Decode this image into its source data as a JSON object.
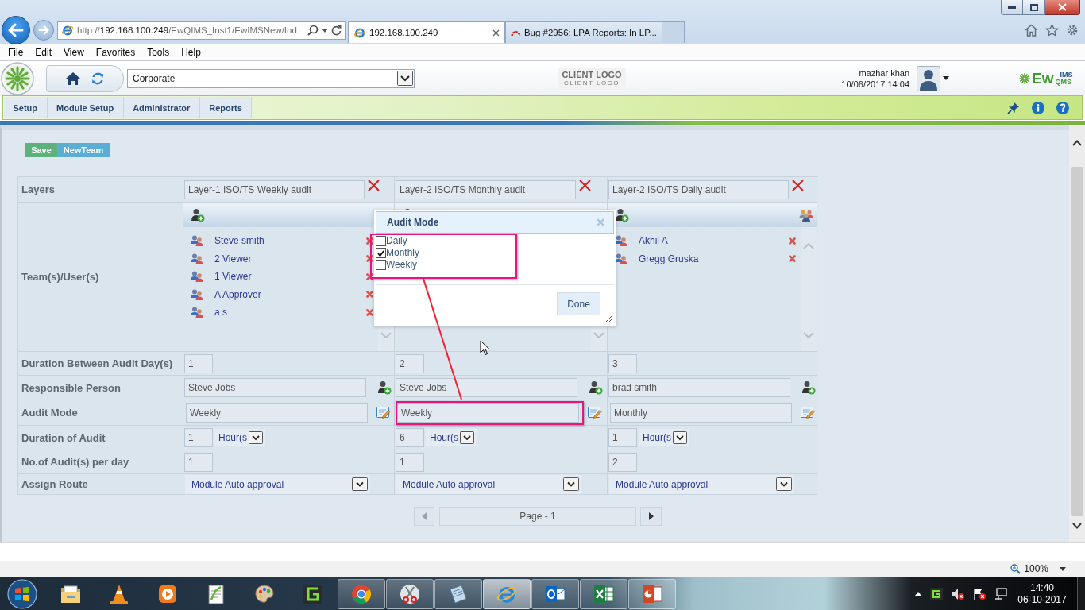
{
  "browser": {
    "url": {
      "scheme": "http://",
      "host": "192.168.100.249",
      "path": "/EwQIMS_Inst1/EwIMSNew/Ind"
    },
    "tabs": [
      {
        "title": "192.168.100.249",
        "selected": true
      },
      {
        "title": "Bug #2956: LPA Reports: In LP...",
        "selected": false
      }
    ],
    "menu": [
      "File",
      "Edit",
      "View",
      "Favorites",
      "Tools",
      "Help"
    ]
  },
  "app_header": {
    "org_select": "Corporate",
    "client_logo": {
      "title": "CLIENT LOGO",
      "tagline": "CLIENT LOGO"
    },
    "user": {
      "name": "mazhar khan",
      "datetime": "10/06/2017 14:04"
    },
    "brand": {
      "main": "Ew",
      "top": "IMS",
      "bottom": "QMS"
    }
  },
  "nav": [
    "Setup",
    "Module Setup",
    "Administrator",
    "Reports"
  ],
  "actions": [
    {
      "label": "Save",
      "kind": "save"
    },
    {
      "label": "NewTeam",
      "kind": "new"
    }
  ],
  "grid": {
    "row_labels": [
      "Layers",
      "Team(s)/User(s)",
      "Duration Between Audit Day(s)",
      "Responsible Person",
      "Audit Mode",
      "Duration of Audit",
      "No.of Audit(s) per day",
      "Assign Route"
    ],
    "columns": [
      {
        "layer": "Layer-1 ISO/TS Weekly audit",
        "users": [
          "Steve smith",
          "2 Viewer",
          "1 Viewer",
          "A Approver",
          "a s"
        ],
        "days_between": "1",
        "responsible": "Steve Jobs",
        "audit_mode": "Weekly",
        "highlighted": false,
        "duration": "1",
        "duration_unit": "Hour(s",
        "audits_per_day": "1",
        "route": "Module Auto approval"
      },
      {
        "layer": "Layer-2 ISO/TS Monthly audit",
        "days_between": "2",
        "responsible": "Steve Jobs",
        "audit_mode": "Weekly",
        "highlighted": true,
        "duration": "6",
        "duration_unit": "Hour(s",
        "audits_per_day": "1",
        "route": "Module Auto approval"
      },
      {
        "layer": "Layer-2 ISO/TS Daily audit",
        "users": [
          "Akhil A",
          "Gregg Gruska"
        ],
        "days_between": "3",
        "responsible": "brad smith",
        "audit_mode": "Monthly",
        "highlighted": false,
        "duration": "1",
        "duration_unit": "Hour(s",
        "audits_per_day": "2",
        "route": "Module Auto approval"
      }
    ]
  },
  "pager": {
    "label": "Page - 1"
  },
  "dialog": {
    "title": "Audit Mode",
    "highlighted": true,
    "options": [
      {
        "label": "Daily",
        "checked": false
      },
      {
        "label": "Monthly",
        "checked": true
      },
      {
        "label": "Weekly",
        "checked": false
      }
    ],
    "button": "Done"
  },
  "status_bar": {
    "zoom": "100%"
  },
  "taskbar": {
    "apps": [
      {
        "kind": "folder",
        "running": false,
        "selected": false
      },
      {
        "kind": "cone",
        "running": false,
        "selected": false
      },
      {
        "kind": "player",
        "running": false,
        "selected": false
      },
      {
        "kind": "editor",
        "running": false,
        "selected": false
      },
      {
        "kind": "palette",
        "running": false,
        "selected": false
      },
      {
        "kind": "spiral",
        "running": false,
        "selected": false
      },
      {
        "kind": "wheel",
        "running": true,
        "selected": false
      },
      {
        "kind": "scissors",
        "running": true,
        "selected": false
      },
      {
        "kind": "notebook",
        "running": true,
        "selected": false
      },
      {
        "kind": "globe",
        "running": true,
        "selected": true
      },
      {
        "kind": "mail",
        "running": true,
        "selected": false
      },
      {
        "kind": "sheet",
        "running": true,
        "selected": false
      },
      {
        "kind": "slides",
        "running": true,
        "selected": false
      }
    ],
    "time": "14:40",
    "date": "06-10-2017"
  }
}
